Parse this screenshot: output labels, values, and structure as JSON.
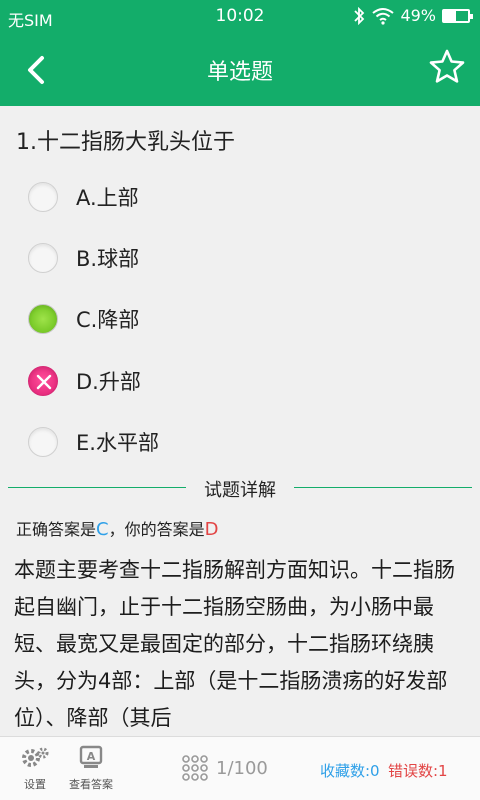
{
  "status": {
    "carrier": "无SIM",
    "time": "10:02",
    "battery": "49%",
    "battery_level": 0.49
  },
  "header": {
    "title": "单选题"
  },
  "question": {
    "text": "1.十二指肠大乳头位于"
  },
  "options": [
    {
      "label": "A.上部",
      "state": "none"
    },
    {
      "label": "B.球部",
      "state": "none"
    },
    {
      "label": "C.降部",
      "state": "correct"
    },
    {
      "label": "D.升部",
      "state": "wrong"
    },
    {
      "label": "E.水平部",
      "state": "none"
    }
  ],
  "detail": {
    "title": "试题详解",
    "correct_prefix": "正确答案是",
    "correct_answer": "C",
    "mine_prefix": "，你的答案是",
    "my_answer": "D",
    "explanation": "本题主要考查十二指肠解剖方面知识。十二指肠起自幽门，止于十二指肠空肠曲，为小肠中最短、最宽又是最固定的部分，十二指肠环绕胰头，分为4部：上部（是十二指肠溃疡的好发部位）、降部（其后"
  },
  "bottom": {
    "settings_label": "设置",
    "view_answer_label": "查看答案",
    "view_answer_icon_letter": "A",
    "pager": "1/100",
    "favorites": "收藏数:0",
    "errors": "错误数:1"
  },
  "colors": {
    "primary": "#13ad6a",
    "correct": "#7ccc2b",
    "wrong": "#e82d7f",
    "blue": "#2fa0e8",
    "red": "#e24545"
  }
}
